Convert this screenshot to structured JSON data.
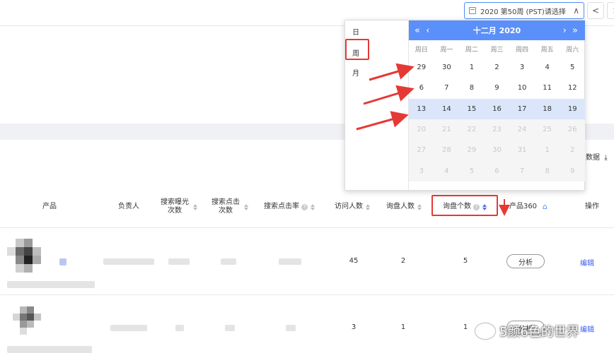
{
  "header": {
    "week_picker_text": "2020 第50周 (PST)请选择",
    "prev_label": "<",
    "next_label": ">"
  },
  "toolbar": {
    "export_label": "数据"
  },
  "table": {
    "columns": {
      "product": "产品",
      "owner": "负责人",
      "search_impressions": "搜索曝光次数",
      "search_clicks": "搜索点击次数",
      "search_ctr": "搜索点击率",
      "visitors": "访问人数",
      "inquirers": "询盘人数",
      "inquiries": "询盘个数",
      "product360": "产品360",
      "actions": "操作"
    },
    "rows": [
      {
        "visitors": "45",
        "inquirers": "2",
        "inquiries": "5",
        "analysis": "分析",
        "edit": "编辑"
      },
      {
        "visitors": "3",
        "inquirers": "1",
        "inquiries": "1",
        "analysis": "分析",
        "edit": "编辑"
      }
    ]
  },
  "dropdown": {
    "granularity": [
      "日",
      "周",
      "月"
    ],
    "selected_granularity": "周",
    "calendar": {
      "month_title": "十二月  2020",
      "weekdays": [
        "周日",
        "周一",
        "周二",
        "周三",
        "周四",
        "周五",
        "周六"
      ],
      "weeks": [
        [
          "29",
          "30",
          "1",
          "2",
          "3",
          "4",
          "5"
        ],
        [
          "6",
          "7",
          "8",
          "9",
          "10",
          "11",
          "12"
        ],
        [
          "13",
          "14",
          "15",
          "16",
          "17",
          "18",
          "19"
        ],
        [
          "20",
          "21",
          "22",
          "23",
          "24",
          "25",
          "26"
        ],
        [
          "27",
          "28",
          "29",
          "30",
          "31",
          "1",
          "2"
        ],
        [
          "3",
          "4",
          "5",
          "6",
          "7",
          "8",
          "9"
        ]
      ]
    }
  },
  "watermark": "5颜6色的世界",
  "colors": {
    "accent": "#5b8ff9",
    "highlight": "#e53935",
    "link": "#3b5cf0"
  }
}
